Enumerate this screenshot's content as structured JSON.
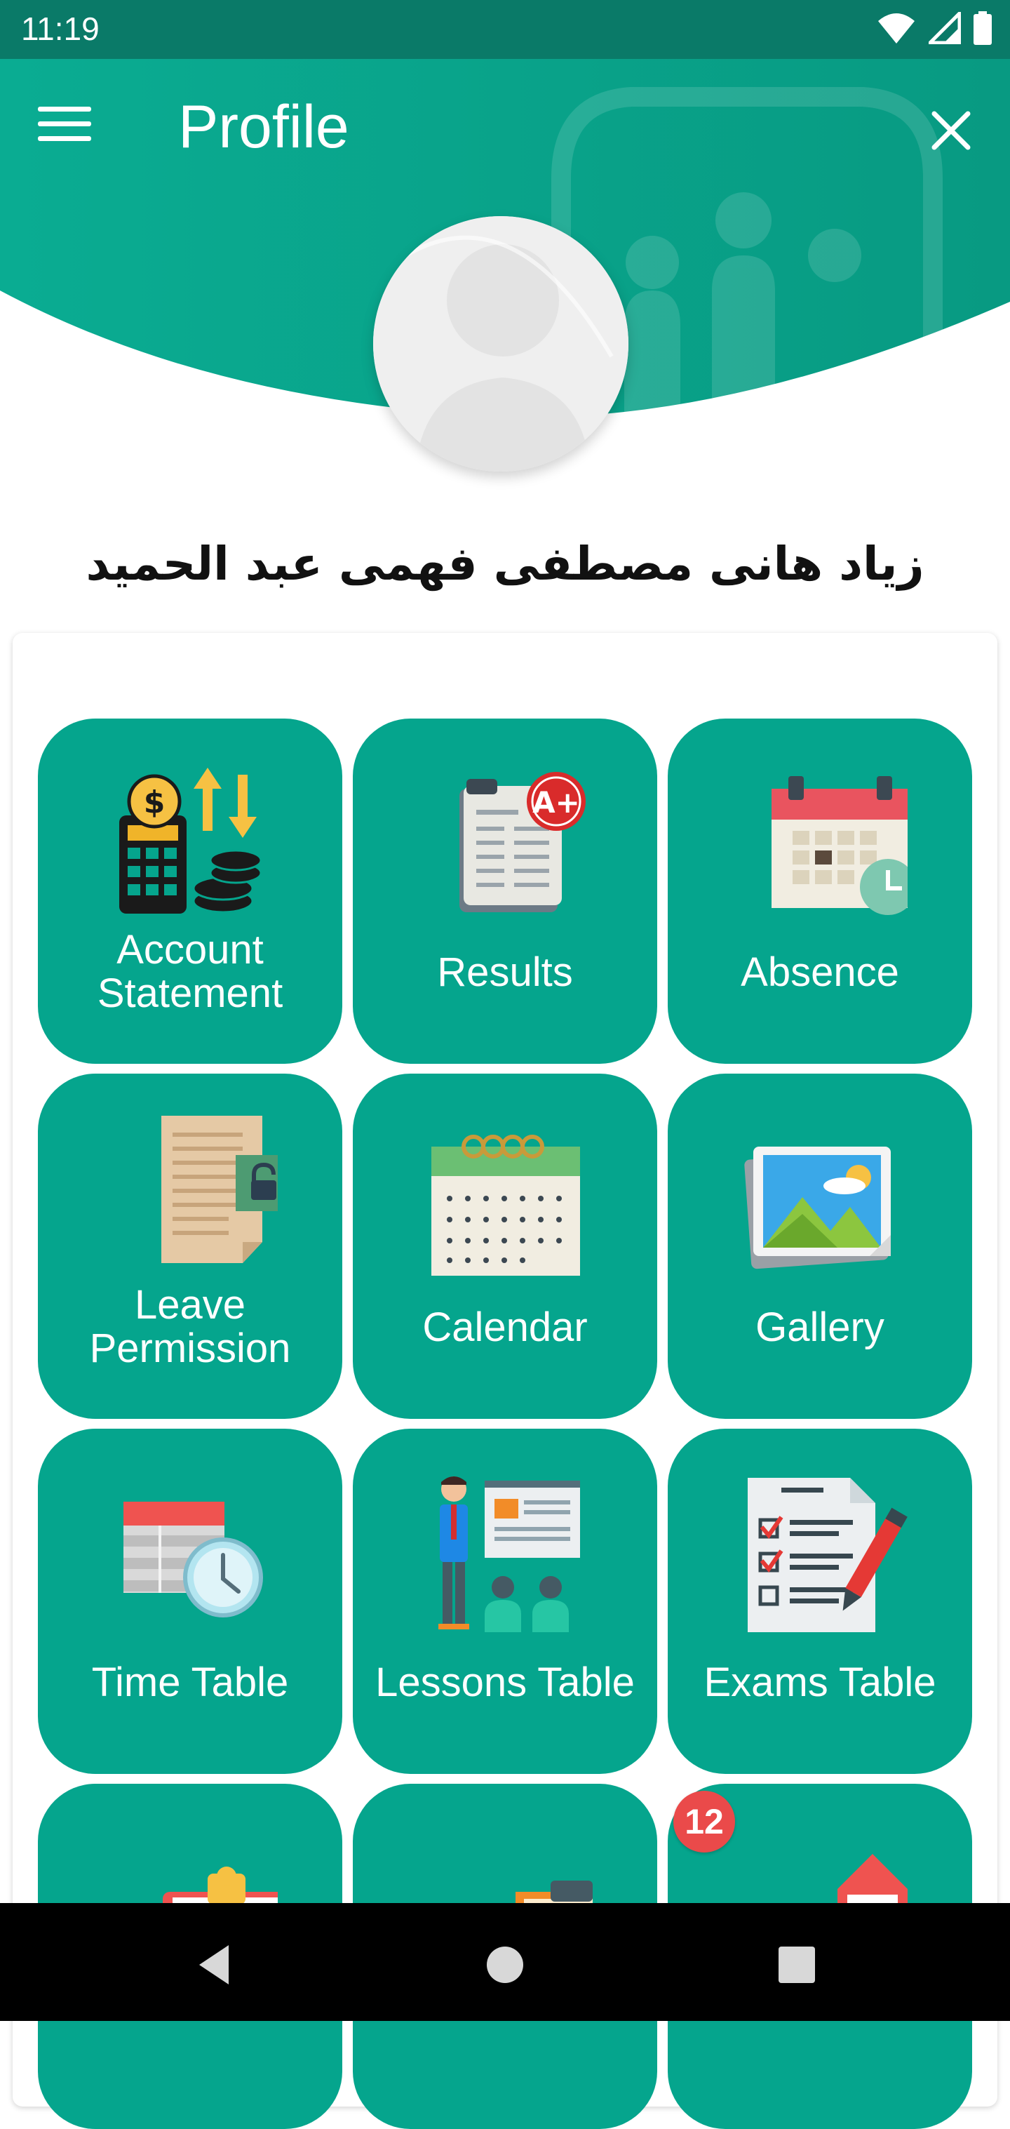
{
  "status_bar": {
    "time": "11:19",
    "icons": [
      "wifi-icon",
      "cellular-signal-icon",
      "battery-icon"
    ]
  },
  "app_bar": {
    "title": "Profile",
    "menu_icon": "hamburger-menu-icon",
    "close_icon": "close-icon",
    "background_color": "#07a98e"
  },
  "profile": {
    "name": "زياد هانى مصطفى فهمى عبد الحميد",
    "avatar_icon": "default-avatar-icon"
  },
  "tiles": [
    {
      "id": "account-statement",
      "label": "Account Statement",
      "label_lines": [
        "Account",
        "Statement"
      ],
      "icon": "calculator-coins-icon"
    },
    {
      "id": "results",
      "label": "Results",
      "label_lines": [
        "Results"
      ],
      "icon": "report-grade-icon"
    },
    {
      "id": "absence",
      "label": "Absence",
      "label_lines": [
        "Absence"
      ],
      "icon": "calendar-clock-icon"
    },
    {
      "id": "leave-permission",
      "label": "Leave Permission",
      "label_lines": [
        "Leave",
        "Permission"
      ],
      "icon": "document-lock-icon"
    },
    {
      "id": "calendar",
      "label": "Calendar",
      "label_lines": [
        "Calendar"
      ],
      "icon": "calendar-icon"
    },
    {
      "id": "gallery",
      "label": "Gallery",
      "label_lines": [
        "Gallery"
      ],
      "icon": "photo-icon"
    },
    {
      "id": "time-table",
      "label": "Time Table",
      "label_lines": [
        "Time Table"
      ],
      "icon": "table-clock-icon"
    },
    {
      "id": "lessons-table",
      "label": "Lessons Table",
      "label_lines": [
        "Lessons Table"
      ],
      "icon": "teacher-icon"
    },
    {
      "id": "exams-table",
      "label": "Exams Table",
      "label_lines": [
        "Exams Table"
      ],
      "icon": "checklist-pencil-icon"
    },
    {
      "id": "tile-10",
      "label": "",
      "label_lines": [],
      "icon": "clipboard-icon"
    },
    {
      "id": "tile-11",
      "label": "",
      "label_lines": [],
      "icon": "clipboard-icon"
    },
    {
      "id": "tile-12",
      "label": "",
      "label_lines": [],
      "icon": "notification-icon",
      "badge": "12"
    }
  ],
  "tile_color": "#05a58d",
  "badge_color": "#ea4a4a",
  "nav_bar": {
    "buttons": [
      "back-icon",
      "home-icon",
      "recents-icon"
    ]
  }
}
